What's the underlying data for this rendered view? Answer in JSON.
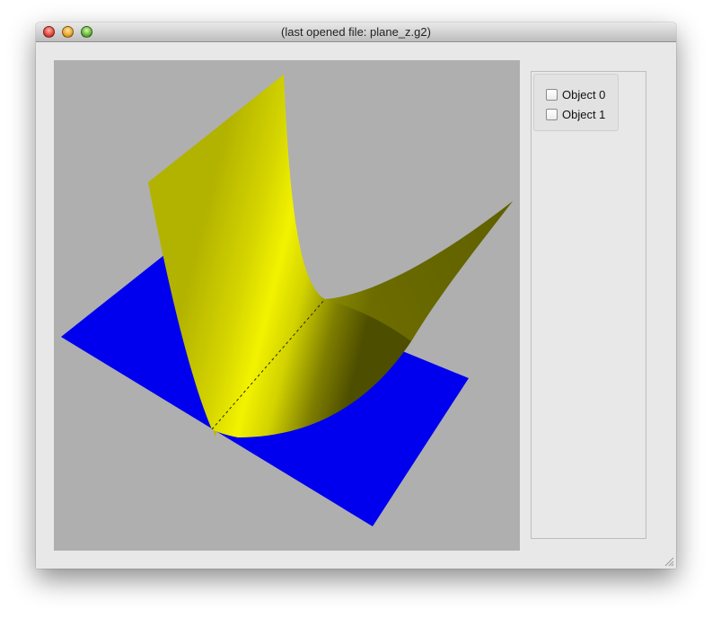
{
  "window": {
    "title": "(last opened file: plane_z.g2)"
  },
  "scene": {
    "background_color": "#afafaf",
    "plane_color": "#0000ee",
    "surface_color": "#eeee00",
    "objects": [
      {
        "label": "Object 0",
        "checked": false
      },
      {
        "label": "Object 1",
        "checked": false
      }
    ]
  },
  "icons": {
    "close": "close-icon",
    "minimize": "minimize-icon",
    "maximize": "maximize-icon",
    "resize": "resize-grip-icon"
  }
}
